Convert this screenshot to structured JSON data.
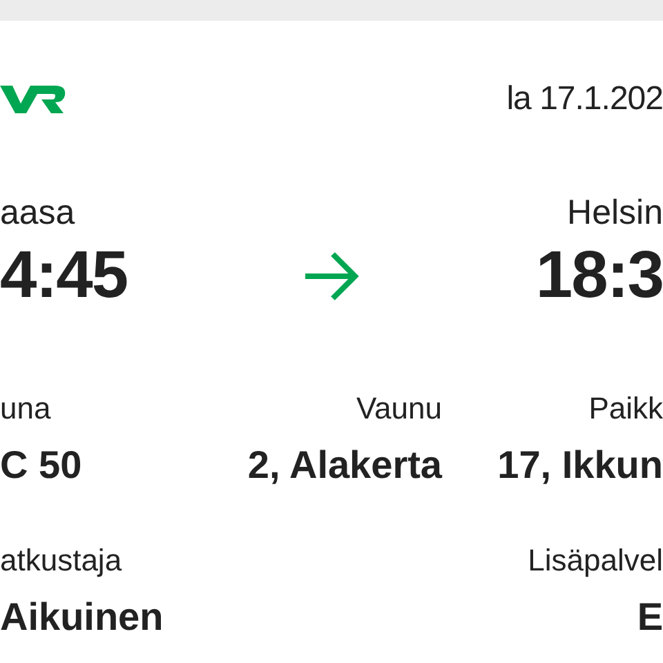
{
  "header": {
    "date": "la 17.1.202"
  },
  "route": {
    "origin": {
      "station": "aasa",
      "time": "4:45"
    },
    "destination": {
      "station": "Helsin",
      "time": "18:3"
    }
  },
  "detail_rows": [
    [
      {
        "kind": "start",
        "label": "una",
        "value": "C 50"
      },
      {
        "kind": "middle",
        "label": "Vaunu",
        "value": "2, Alakerta"
      },
      {
        "kind": "end",
        "label": "Paikk",
        "value": "17, Ikkun"
      }
    ],
    [
      {
        "kind": "start",
        "label": "atkustaja",
        "value": "Aikuinen"
      },
      {
        "kind": "end",
        "label": "Lisäpalvel",
        "value": "E"
      }
    ]
  ]
}
